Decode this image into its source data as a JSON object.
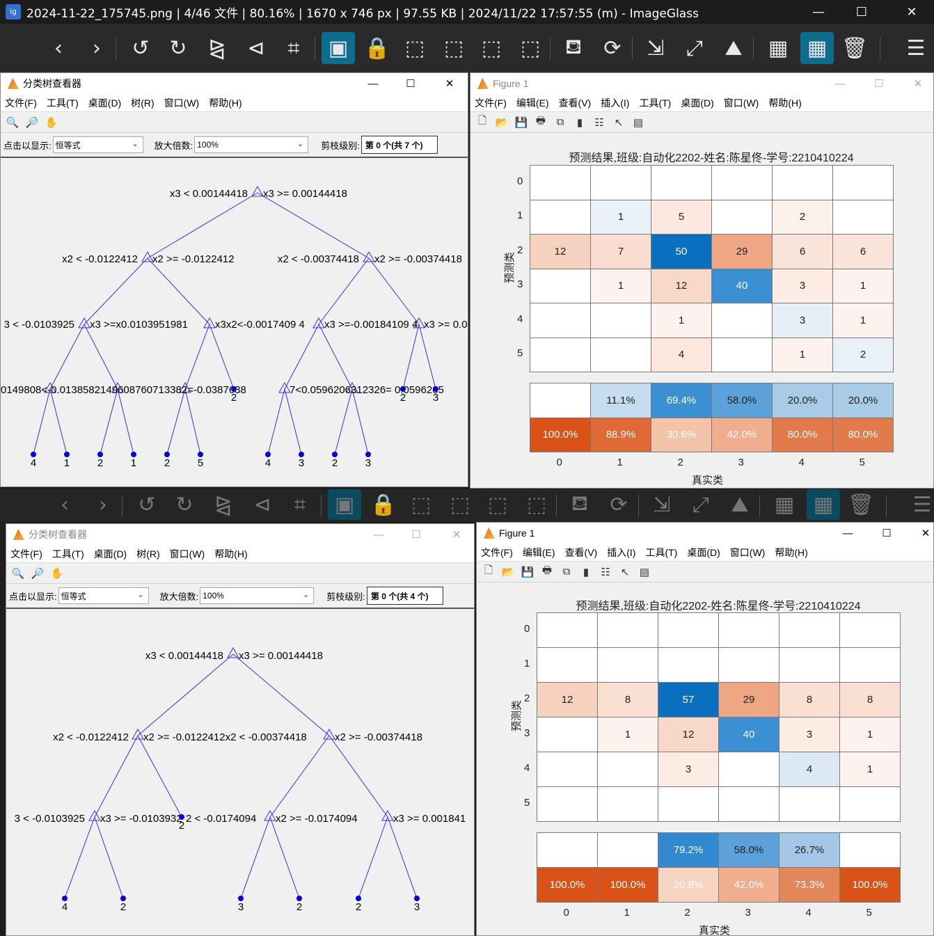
{
  "app": {
    "title": "2024-11-22_175745.png  |  4/46 文件  |  80.16%  |  1670 x 746 px  |  97.55 KB  |  2024/11/22 17:57:55 (m)  - ImageGlass",
    "minimize": "—",
    "maximize": "☐",
    "close": "✕"
  },
  "toolbar_icons": [
    "prev-icon",
    "next-icon",
    "rotate-left-icon",
    "rotate-right-icon",
    "flip-horizontal-icon",
    "flip-vertical-icon",
    "crop-icon",
    "view-actual-icon",
    "lock-zoom-icon",
    "zoom-fit-icon",
    "scale-width-icon",
    "scale-height-icon",
    "auto-zoom-icon",
    "color-picker-icon",
    "refresh-icon",
    "open-location-icon",
    "fullscreen-icon",
    "set-wallpaper-icon",
    "gallery-icon",
    "thumbnail-icon",
    "delete-icon",
    "menu-icon"
  ],
  "tree_top": {
    "title": "分类树查看器",
    "menu": [
      "文件(F)",
      "工具(T)",
      "桌面(D)",
      "树(R)",
      "窗口(W)",
      "帮助(H)"
    ],
    "click_label": "点击以显示:",
    "click_value": "恒等式",
    "zoom_label": "放大倍数:",
    "zoom_value": "100%",
    "prune_label": "剪枝级别:",
    "prune_value": "第 0 个(共 7 个)",
    "labels": [
      "x3 < 0.00144418",
      "x3 >= 0.00144418",
      "x2 < -0.0122412",
      "x2 >= -0.0122412",
      "x2 < -0.00374418",
      "x2 >= -0.00374418",
      "3 < -0.0103925",
      "x3 >=x0.0103951981",
      "x3x2<-0.0017409 4",
      "x3 >=-0.00184109 4",
      "x3 >= 0.0",
      "0149808<-0.0138582149608760713382=-0.0387638",
      "7<0.0596206312326= 0.0596205",
      "4",
      "1",
      "2",
      "1",
      "2",
      "5",
      "2",
      "4",
      "3",
      "2",
      "3",
      "2",
      "3"
    ]
  },
  "figure_top": {
    "title": "Figure 1",
    "menu": [
      "文件(F)",
      "编辑(E)",
      "查看(V)",
      "插入(I)",
      "工具(T)",
      "桌面(D)",
      "窗口(W)",
      "帮助(H)"
    ],
    "chart_title": "预测结果,班级:自动化2202-姓名:陈星佟-学号:2210410224",
    "ylabel": "预测类",
    "xlabel": "真实类",
    "ticks": [
      "0",
      "1",
      "2",
      "3",
      "4",
      "5"
    ],
    "matrix": [
      [
        "",
        "",
        "",
        "",
        "",
        ""
      ],
      [
        "",
        "1",
        "5",
        "",
        "2",
        ""
      ],
      [
        "12",
        "7",
        "50",
        "29",
        "6",
        "6"
      ],
      [
        "",
        "1",
        "12",
        "40",
        "3",
        "1"
      ],
      [
        "",
        "",
        "1",
        "",
        "3",
        "1"
      ],
      [
        "",
        "",
        "4",
        "",
        "1",
        "2"
      ]
    ],
    "colors": [
      [
        "#ffffff",
        "#ffffff",
        "#ffffff",
        "#ffffff",
        "#ffffff",
        "#ffffff"
      ],
      [
        "#ffffff",
        "#eaf1f8",
        "#fbe8df",
        "#ffffff",
        "#fdf1ec",
        "#ffffff"
      ],
      [
        "#f7d2c0",
        "#f9ddd0",
        "#0b6fbf",
        "#eea684",
        "#fae4d9",
        "#fae4d9"
      ],
      [
        "#ffffff",
        "#fdf2ee",
        "#f8d8c9",
        "#3b8fd3",
        "#fdece4",
        "#fdf2ee"
      ],
      [
        "#ffffff",
        "#ffffff",
        "#fdf2ee",
        "#ffffff",
        "#e6eff8",
        "#fdf2ee"
      ],
      [
        "#ffffff",
        "#ffffff",
        "#fbe7dd",
        "#ffffff",
        "#fdf2ee",
        "#e9f1f8"
      ]
    ],
    "summary_top": [
      "",
      "11.1%",
      "69.4%",
      "58.0%",
      "20.0%",
      "20.0%"
    ],
    "summary_top_colors": [
      "#ffffff",
      "#c6dcf0",
      "#3b8fd3",
      "#5ca1d9",
      "#a9cbe8",
      "#a9cbe8"
    ],
    "summary_bottom": [
      "100.0%",
      "88.9%",
      "30.6%",
      "42.0%",
      "80.0%",
      "80.0%"
    ],
    "summary_bottom_colors": [
      "#d95319",
      "#df6a35",
      "#f3c3aa",
      "#f0ae8e",
      "#e27b4c",
      "#e27b4c"
    ]
  },
  "tree_bottom": {
    "title": "分类树查看器",
    "menu": [
      "文件(F)",
      "工具(T)",
      "桌面(D)",
      "树(R)",
      "窗口(W)",
      "帮助(H)"
    ],
    "click_label": "点击以显示:",
    "click_value": "恒等式",
    "zoom_label": "放大倍数:",
    "zoom_value": "100%",
    "prune_label": "剪枝级别:",
    "prune_value": "第 0 个(共 4 个)",
    "labels": [
      "x3 < 0.00144418",
      "x3 >= 0.00144418",
      "x2 < -0.0122412",
      "x2 >= -0.0122412x2 < -0.00374418",
      "x2 >= -0.00374418",
      "3 < -0.0103925",
      "x3 >= -0.0103932",
      "2 < -0.0174094",
      "x2 >= -0.0174094",
      "x3 >= 0.001841",
      "4",
      "2",
      "2",
      "3",
      "2",
      "2",
      "3"
    ]
  },
  "figure_bottom": {
    "title": "Figure 1",
    "menu": [
      "文件(F)",
      "编辑(E)",
      "查看(V)",
      "插入(I)",
      "工具(T)",
      "桌面(D)",
      "窗口(W)",
      "帮助(H)"
    ],
    "chart_title": "预测结果,班级:自动化2202-姓名:陈星佟-学号:2210410224",
    "ylabel": "预测类",
    "xlabel": "真实类",
    "ticks": [
      "0",
      "1",
      "2",
      "3",
      "4",
      "5"
    ],
    "matrix": [
      [
        "",
        "",
        "",
        "",
        "",
        ""
      ],
      [
        "",
        "",
        "",
        "",
        "",
        ""
      ],
      [
        "12",
        "8",
        "57",
        "29",
        "8",
        "8"
      ],
      [
        "",
        "1",
        "12",
        "40",
        "3",
        "1"
      ],
      [
        "",
        "",
        "3",
        "",
        "4",
        "1"
      ],
      [
        "",
        "",
        "",
        "",
        "",
        ""
      ]
    ],
    "colors": [
      [
        "#ffffff",
        "#ffffff",
        "#ffffff",
        "#ffffff",
        "#ffffff",
        "#ffffff"
      ],
      [
        "#ffffff",
        "#ffffff",
        "#ffffff",
        "#ffffff",
        "#ffffff",
        "#ffffff"
      ],
      [
        "#f7d2c0",
        "#fae0d3",
        "#0b6fbf",
        "#eea684",
        "#fae0d3",
        "#fae0d3"
      ],
      [
        "#ffffff",
        "#fdf2ee",
        "#f8d8c9",
        "#3b8fd3",
        "#fdece4",
        "#fdf2ee"
      ],
      [
        "#ffffff",
        "#ffffff",
        "#fdece4",
        "#ffffff",
        "#dce9f5",
        "#fdf2ee"
      ],
      [
        "#ffffff",
        "#ffffff",
        "#ffffff",
        "#ffffff",
        "#ffffff",
        "#ffffff"
      ]
    ],
    "summary_top": [
      "",
      "",
      "79.2%",
      "58.0%",
      "26.7%",
      ""
    ],
    "summary_top_colors": [
      "#ffffff",
      "#ffffff",
      "#3389cf",
      "#5ca1d9",
      "#a3c7e6",
      "#ffffff"
    ],
    "summary_bottom": [
      "100.0%",
      "100.0%",
      "20.8%",
      "42.0%",
      "73.3%",
      "100.0%"
    ],
    "summary_bottom_colors": [
      "#d95319",
      "#d95319",
      "#f7d3c1",
      "#f0ae8e",
      "#e3875b",
      "#d95319"
    ]
  }
}
